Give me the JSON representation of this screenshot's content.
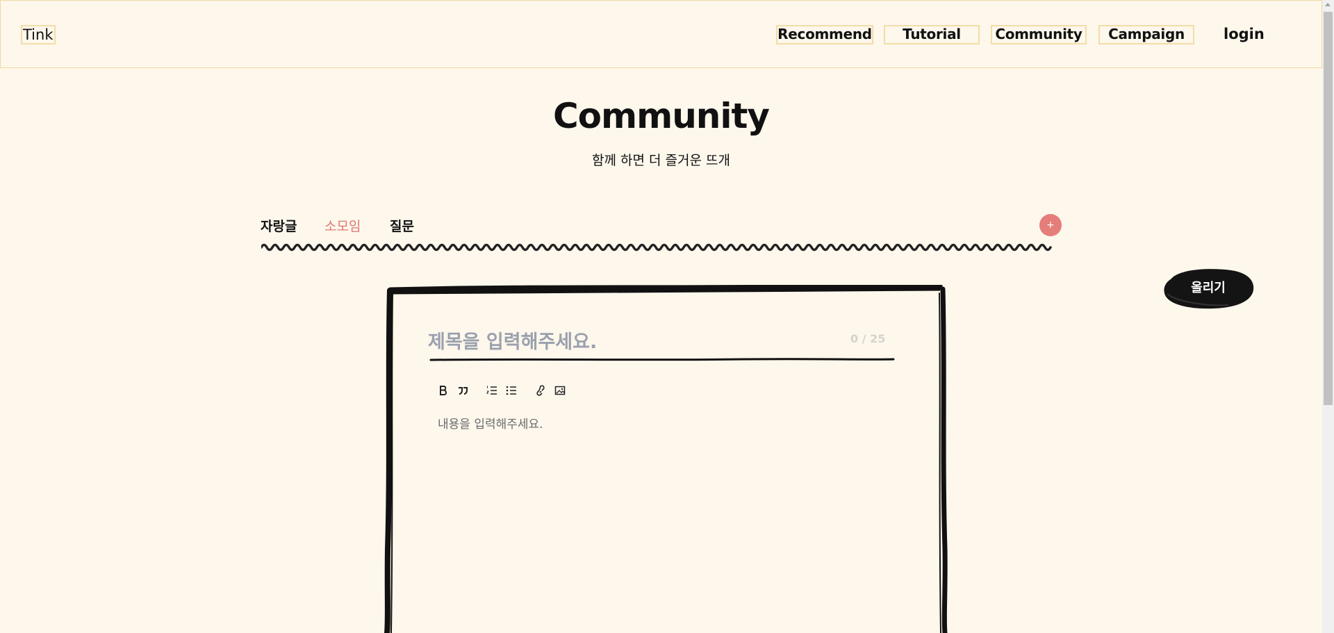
{
  "header": {
    "logo": "Tink",
    "nav": [
      "Recommend",
      "Tutorial",
      "Community",
      "Campaign"
    ],
    "login": "login"
  },
  "page": {
    "title": "Community",
    "subtitle": "함께 하면 더 즐거운 뜨개"
  },
  "tabs": [
    {
      "label": "자랑글",
      "active": false
    },
    {
      "label": "소모임",
      "active": true
    },
    {
      "label": "질문",
      "active": false
    }
  ],
  "add_button": "+",
  "post_button": "올리기",
  "editor": {
    "title_placeholder": "제목을 입력해주세요.",
    "char_count": "0 / 25",
    "content_placeholder": "내용을 입력해주세요.",
    "toolbar_icons": [
      "bold-icon",
      "quote-icon",
      "ordered-list-icon",
      "bullet-list-icon",
      "link-icon",
      "image-icon"
    ]
  },
  "colors": {
    "background": "#fdf7ec",
    "accent": "#e57d7a",
    "outline": "#f3dca6"
  }
}
